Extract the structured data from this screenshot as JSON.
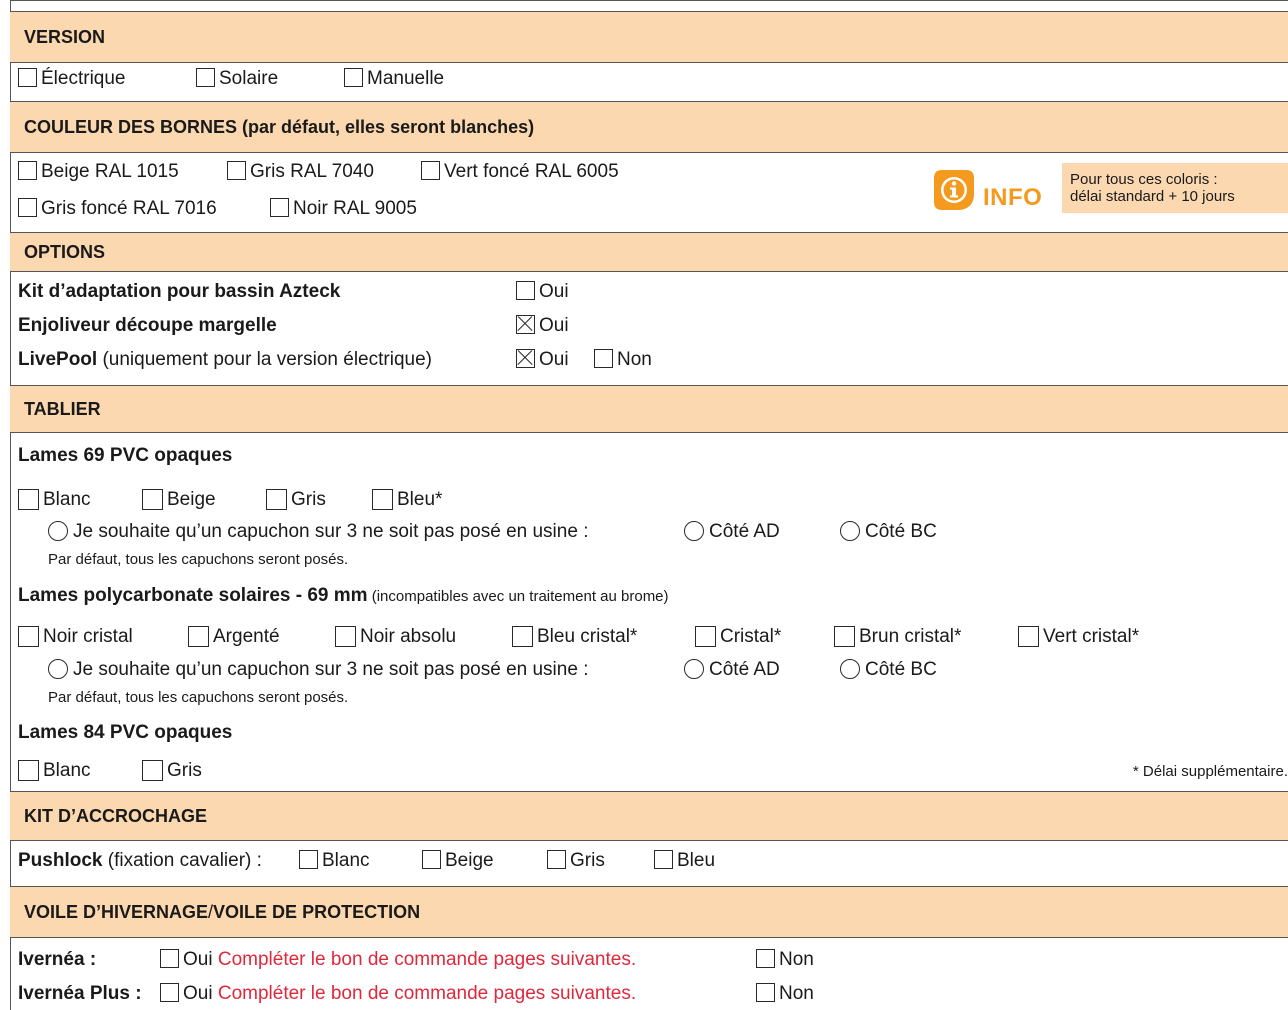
{
  "version": {
    "header": "VERSION",
    "options": [
      "Électrique",
      "Solaire",
      "Manuelle"
    ]
  },
  "couleur": {
    "header": "COULEUR DES BORNES (par défaut, elles seront blanches)",
    "row1": [
      "Beige RAL 1015",
      "Gris RAL 7040",
      "Vert foncé RAL 6005"
    ],
    "row2": [
      "Gris foncé RAL 7016",
      "Noir RAL 9005"
    ],
    "info_label": "INFO",
    "info_text_1": "Pour tous ces coloris :",
    "info_text_2": "délai standard + 10 jours",
    "info_color": "#f39a1f"
  },
  "options": {
    "header": "OPTIONS",
    "kit_label": "Kit d’adaptation pour bassin Azteck",
    "kit_oui": "Oui",
    "enjoliveur_label": "Enjoliveur découpe margelle",
    "enjoliveur_oui": "Oui",
    "livepool_label": "LivePool",
    "livepool_note": " (uniquement pour la version électrique)",
    "livepool_oui": "Oui",
    "livepool_non": "Non"
  },
  "tablier": {
    "header": "TABLIER",
    "pvc69_title": "Lames 69 PVC opaques",
    "pvc69_options": [
      "Blanc",
      "Beige",
      "Gris",
      "Bleu*"
    ],
    "capuchon_text": "Je souhaite qu’un capuchon sur 3 ne soit pas posé en usine :",
    "cote_ad": "Côté AD",
    "cote_bc": "Côté BC",
    "defaut_text": "Par défaut, tous les capuchons seront posés.",
    "poly_title": "Lames polycarbonate solaires - 69 mm",
    "poly_note": " (incompatibles avec un traitement au brome)",
    "poly_options": [
      "Noir cristal",
      "Argenté",
      "Noir absolu",
      "Bleu cristal*",
      "Cristal*",
      "Brun cristal*",
      "Vert cristal*"
    ],
    "pvc84_title": "Lames 84 PVC opaques",
    "pvc84_options": [
      "Blanc",
      "Gris"
    ],
    "delai_note": "* Délai supplémentaire."
  },
  "kit": {
    "header": "KIT D’ACCROCHAGE",
    "pushlock_label": "Pushlock",
    "pushlock_note": " (fixation cavalier) :",
    "options": [
      "Blanc",
      "Beige",
      "Gris",
      "Bleu"
    ]
  },
  "voile": {
    "header_a": "VOILE D’HIVERNAGE",
    "header_sep": " / ",
    "header_b": "VOILE DE PROTECTION",
    "ivernea_label": "Ivernéa :",
    "ivernea_plus_label": "Ivernéa Plus :",
    "oui": "Oui",
    "complete_text": "Compléter le bon de commande pages suivantes.",
    "non": "Non",
    "link_color": "#e0283c"
  }
}
